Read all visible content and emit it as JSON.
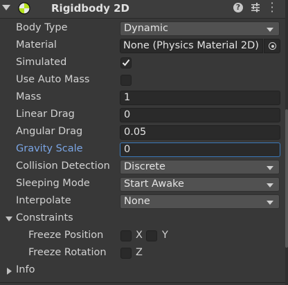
{
  "component": {
    "title": "Rigidbody 2D",
    "icon": "rigidbody2d-icon",
    "help_icon": "help-icon",
    "preset_icon": "preset-icon",
    "menu_icon": "kebab-menu-icon"
  },
  "fields": {
    "body_type": {
      "label": "Body Type",
      "value": "Dynamic"
    },
    "material": {
      "label": "Material",
      "value": "None (Physics Material 2D)"
    },
    "simulated": {
      "label": "Simulated",
      "checked": true
    },
    "use_auto_mass": {
      "label": "Use Auto Mass",
      "checked": false
    },
    "mass": {
      "label": "Mass",
      "value": "1"
    },
    "linear_drag": {
      "label": "Linear Drag",
      "value": "0"
    },
    "angular_drag": {
      "label": "Angular Drag",
      "value": "0.05"
    },
    "gravity_scale": {
      "label": "Gravity Scale",
      "value": "0"
    },
    "collision_detection": {
      "label": "Collision Detection",
      "value": "Discrete"
    },
    "sleeping_mode": {
      "label": "Sleeping Mode",
      "value": "Start Awake"
    },
    "interpolate": {
      "label": "Interpolate",
      "value": "None"
    }
  },
  "constraints": {
    "label": "Constraints",
    "freeze_position": {
      "label": "Freeze Position",
      "x_label": "X",
      "y_label": "Y",
      "x": false,
      "y": false
    },
    "freeze_rotation": {
      "label": "Freeze Rotation",
      "z_label": "Z",
      "z": false
    }
  },
  "info": {
    "label": "Info"
  },
  "colors": {
    "background": "#383838",
    "highlight_label": "#7ba6e6",
    "focus_border": "#3a79bb"
  }
}
